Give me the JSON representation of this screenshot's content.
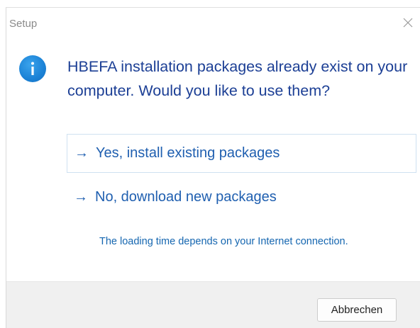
{
  "window": {
    "title": "Setup",
    "close_icon": "close-icon"
  },
  "dialog": {
    "icon": "info-icon",
    "message": "HBEFA installation packages already exist on your computer. Would you like to use them?",
    "options": [
      {
        "arrow": "→",
        "label": "Yes, install existing packages",
        "highlighted": true
      },
      {
        "arrow": "→",
        "label": "No, download new packages",
        "highlighted": false
      }
    ],
    "note": "The loading time depends on your Internet connection."
  },
  "footer": {
    "cancel_label": "Abbrechen"
  },
  "colors": {
    "accent": "#1f5fb0",
    "message": "#1c3f95",
    "info_icon": "#1b82d6",
    "footer_bg": "#f0f0f0"
  }
}
